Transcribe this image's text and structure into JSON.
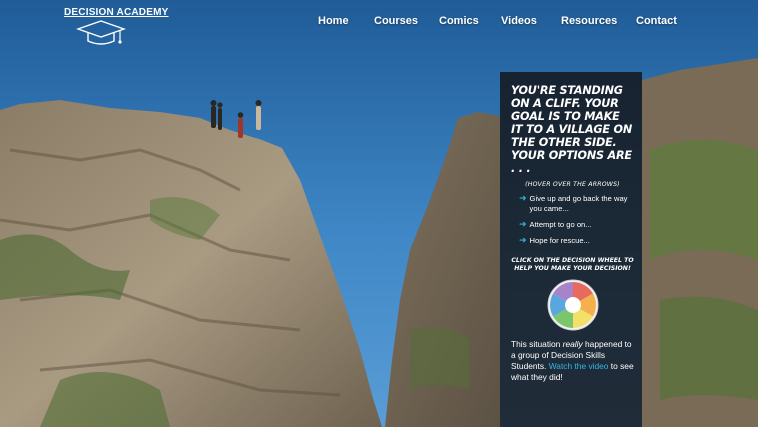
{
  "logo": {
    "text": "DECISION ACADEMY",
    "icon": "graduation-cap-icon"
  },
  "nav": {
    "items": [
      "Home",
      "Courses",
      "Comics",
      "Videos",
      "Resources",
      "Contact"
    ]
  },
  "panel": {
    "headline": "You're standing on a cliff. Your goal is to make it to a village on the other side. Your options are . . .",
    "hover_note": "(HOVER OVER THE ARROWS)",
    "options": [
      "Give up and go back the way you came...",
      "Attempt to go on...",
      "Hope for rescue..."
    ],
    "click_note": "CLICK ON THE DECISION WHEEL TO HELP YOU MAKE YOUR DECISION!",
    "story_1": "This situation ",
    "story_emph": "really",
    "story_2": " happened to a group of Decision Skills Students. ",
    "story_link": "Watch the video",
    "story_3": " to see what they did!"
  },
  "colors": {
    "sky": "#3a79b6",
    "panel": "#141416",
    "link": "#33b8e6",
    "arrow": "#32b4d8"
  }
}
